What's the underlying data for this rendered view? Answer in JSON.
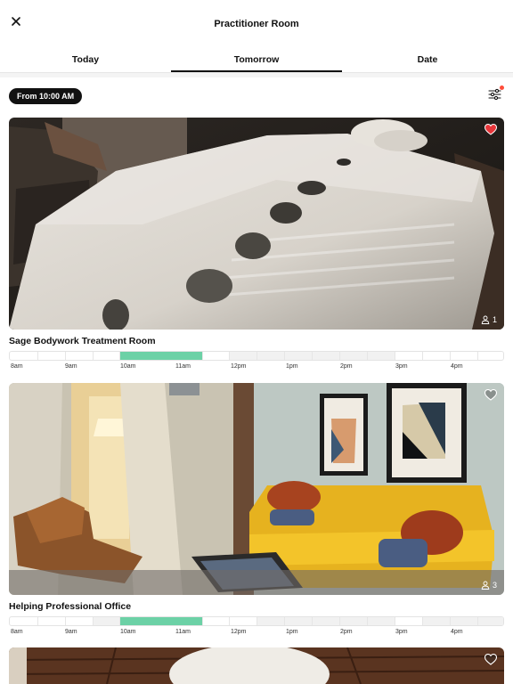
{
  "header": {
    "title": "Practitioner Room",
    "close_icon": "close-icon"
  },
  "tabs": [
    {
      "label": "Today",
      "active": false
    },
    {
      "label": "Tomorrow",
      "active": true
    },
    {
      "label": "Date",
      "active": false
    }
  ],
  "filter": {
    "time_pill": "From 10:00 AM",
    "filter_icon": "sliders-icon",
    "has_active_filter": true
  },
  "timeline_labels": [
    "8am",
    "9am",
    "10am",
    "11am",
    "12pm",
    "1pm",
    "2pm",
    "3pm",
    "4pm"
  ],
  "rooms": [
    {
      "name": "Sage Bodywork Treatment Room",
      "capacity": "1",
      "favorited": true,
      "photo_icon": "massage-table-photo",
      "selected_range": [
        "10am",
        "11:30am"
      ]
    },
    {
      "name": "Helping Professional Office",
      "capacity": "3",
      "favorited": false,
      "photo_icon": "office-room-photo",
      "selected_range": [
        "10am",
        "11:30am"
      ]
    },
    {
      "name": "",
      "capacity": "",
      "favorited": false,
      "photo_icon": "room-photo"
    }
  ],
  "colors": {
    "accent_green": "#6cd1a6",
    "favorite_red": "#e8363a",
    "filter_dot": "#ff4d3a"
  }
}
